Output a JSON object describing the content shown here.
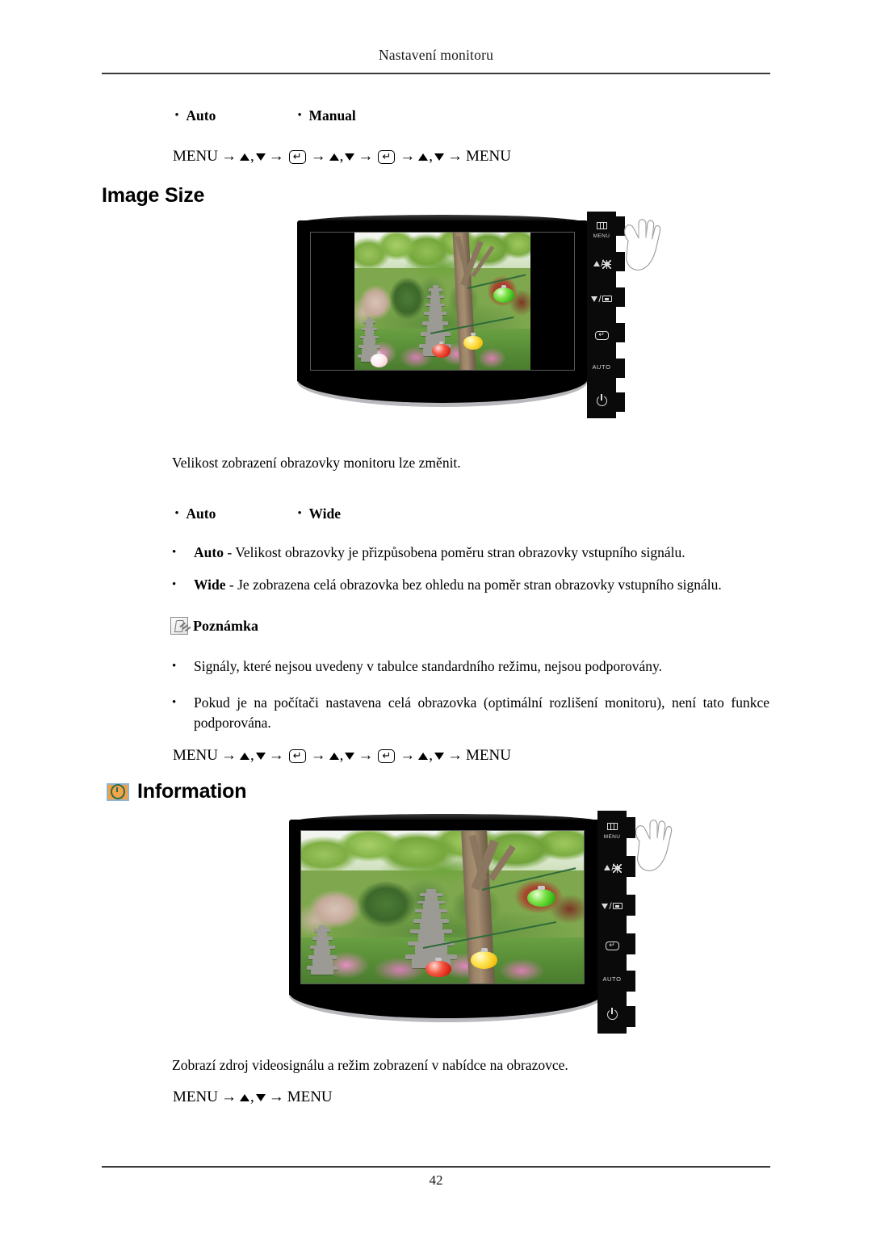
{
  "header": {
    "running_head": "Nastavení monitoru"
  },
  "footer": {
    "page_number": "42"
  },
  "top_options": {
    "option_1": "Auto",
    "option_2": "Manual"
  },
  "menu_paths": {
    "path_1": {
      "start": "MENU",
      "end": "MENU",
      "arrow": "→",
      "comma": ",",
      "enter_symbol": "↵"
    },
    "path_2": {
      "start": "MENU",
      "end": "MENU",
      "arrow": "→",
      "comma": ",",
      "enter_symbol": "↵"
    },
    "path_3": {
      "start": "MENU",
      "end": "MENU",
      "arrow": "→",
      "comma": ",",
      "enter_symbol": "↵"
    }
  },
  "image_size_section": {
    "heading": "Image Size",
    "description": "Velikost zobrazení obrazovky monitoru lze změnit.",
    "options": {
      "option_1": "Auto",
      "option_2": "Wide"
    },
    "bullets": [
      {
        "term": "Auto",
        "dash": "-",
        "text": "Velikost obrazovky je přizpůsobena poměru stran obrazovky vstupního signálu."
      },
      {
        "term": "Wide",
        "dash": "-",
        "text": "Je zobrazena celá obrazovka bez ohledu na poměr stran obrazovky vstupního signálu."
      }
    ],
    "note": {
      "title": "Poznámka",
      "items": [
        "Signály, které nejsou uvedeny v tabulce standardního režimu, nejsou podporovány.",
        "Pokud je na počítači nastavena celá obrazovka (optimální rozlišení monitoru), není tato funkce podporována."
      ]
    }
  },
  "information_section": {
    "heading": "Information",
    "description": "Zobrazí zdroj videosignálu a režim zobrazení v nabídce na obrazovce."
  },
  "monitor_panel": {
    "buttons": [
      {
        "name": "menu",
        "label": "MENU",
        "icon": "menu-bars-icon"
      },
      {
        "name": "up-brightness",
        "label": "",
        "icon": "up-triangle-brightness-icon"
      },
      {
        "name": "down-source",
        "label": "",
        "icon": "down-triangle-source-icon"
      },
      {
        "name": "enter",
        "label": "",
        "icon": "enter-icon"
      },
      {
        "name": "auto",
        "label": "AUTO",
        "icon": "auto-text-icon"
      },
      {
        "name": "power",
        "label": "",
        "icon": "power-icon"
      }
    ]
  },
  "colors": {
    "accent_orange": "#f5a03c",
    "icon_border_blue": "#8fb5d5",
    "bezel_black": "#000000",
    "rule_gray": "#3a3a3a"
  }
}
